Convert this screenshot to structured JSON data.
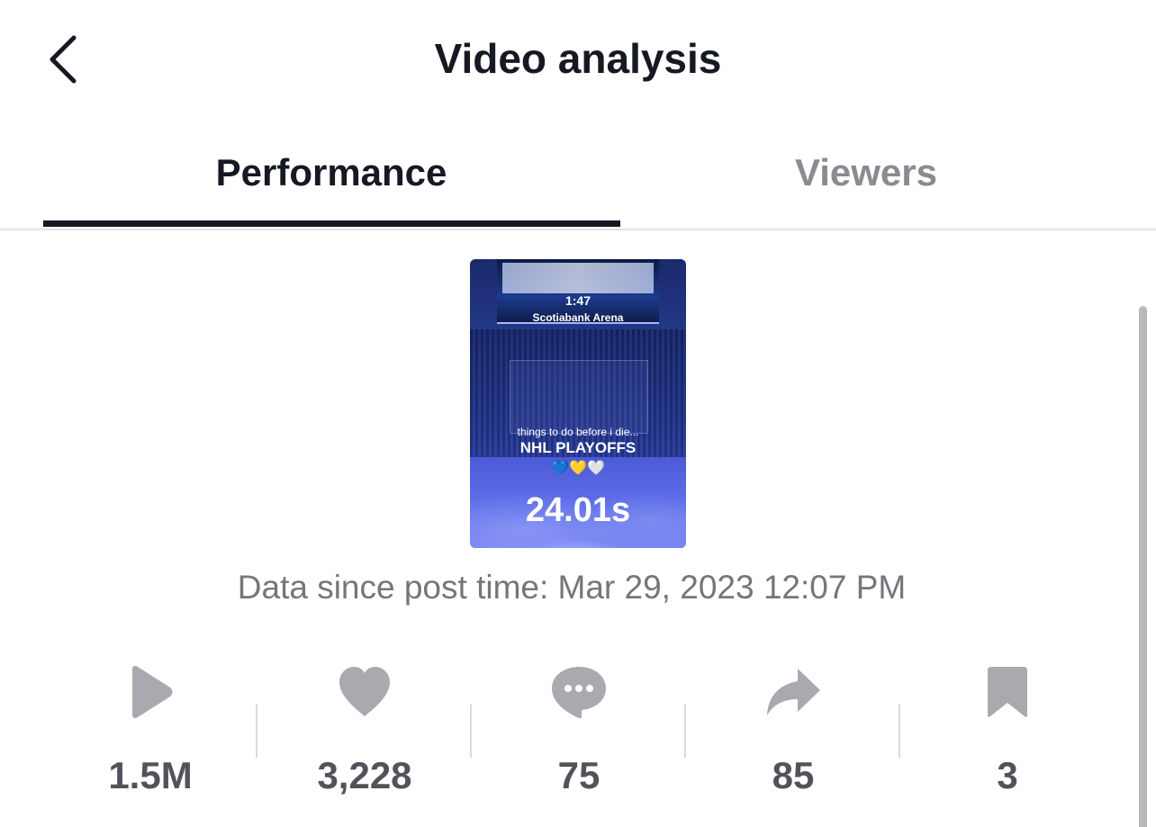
{
  "header": {
    "title": "Video analysis",
    "back_icon": "chevron-left-icon"
  },
  "tabs": [
    {
      "label": "Performance",
      "active": true
    },
    {
      "label": "Viewers",
      "active": false
    }
  ],
  "video": {
    "duration": "24.01s",
    "thumbnail_text": {
      "score_time": "1:47",
      "arena": "Scotiabank Arena",
      "caption_small": "things to do before i die...",
      "caption": "NHL PLAYOFFS",
      "hearts": "💙💛🤍"
    }
  },
  "data_since": "Data since post time: Mar 29, 2023 12:07 PM",
  "stats": [
    {
      "icon": "play-icon",
      "value": "1.5M"
    },
    {
      "icon": "heart-icon",
      "value": "3,228"
    },
    {
      "icon": "comment-icon",
      "value": "75"
    },
    {
      "icon": "share-icon",
      "value": "85"
    },
    {
      "icon": "bookmark-icon",
      "value": "3"
    }
  ],
  "colors": {
    "primary_text": "#161823",
    "inactive_tab": "#8a8b91",
    "secondary_text": "#75767c",
    "stat_icon": "#a9aaaf",
    "stat_value": "#52535a"
  }
}
